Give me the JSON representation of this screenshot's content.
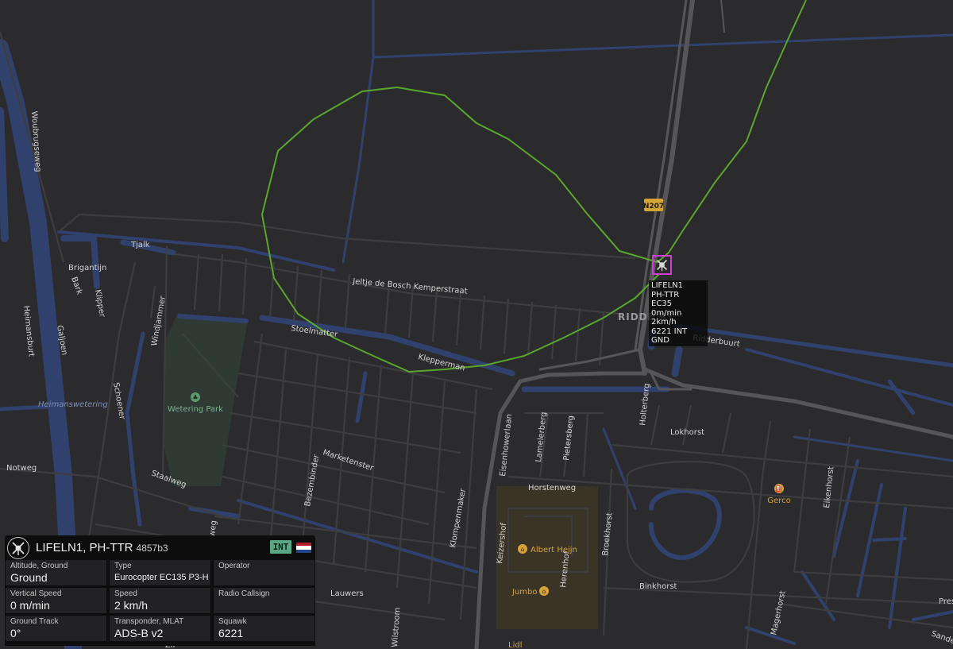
{
  "map": {
    "colors": {
      "background": "#2b2b2d",
      "water": "#30416e",
      "road": "#3d3d40",
      "highway": "#565659",
      "track": "#5aa72e",
      "park": "#2f3a34",
      "shopping": "#3a3426",
      "marker": "#d33cd6"
    },
    "road_shield": "N207",
    "area_label": "RIDDERVELD",
    "area_label_visible": "RIDDE      RT",
    "water_label": "Heimanswetering",
    "streets": {
      "woubrugseweg": "Woubrugseweg",
      "heimansburt": "Heimansburt",
      "galjoen": "Galjoen",
      "bark": "Bark",
      "klipper": "Klipper",
      "brigantijn": "Brigantijn",
      "tjalk": "Tjalk",
      "jeltje": "Jeltje de Bosch Kemperstraat",
      "stoelmatter": "Stoelmatter",
      "klepperman": "Klepperman",
      "windjammer": "Windjammer",
      "schoener": "Schoener",
      "notweg": "Notweg",
      "staalweg": "Staalweg",
      "markettenster": "Marketenster",
      "bezembinder": "Bezembinder",
      "klompenmaker": "Klompenmaker",
      "eisenhowerlaan": "Eisenhowerlaan",
      "lamelerberg": "Lamelerberg",
      "pietersberg": "Pietersberg",
      "horstenweg": "Horstenweg",
      "keizershof": "Keizershof",
      "herenhof": "Herenhof",
      "broekhorst": "Broekhorst",
      "binkhorst": "Binkhorst",
      "lokhorst": "Lokhorst",
      "holterberg": "Holterberg",
      "ridderbuurt": "Ridderbuurt",
      "eikenhorst": "Eikenhorst",
      "magerhorst": "Magerhorst",
      "lauwers": "Lauwers",
      "wilstroom": "Wilstroom",
      "weg": "weg",
      "pres": "Pres",
      "sanden": "Sanden",
      "zil": "Zil",
      "lidl": "Lidl"
    },
    "pois": {
      "park": "Wetering Park",
      "albert_heijn": "Albert Heijn",
      "jumbo": "Jumbo",
      "gerco": "Gerco"
    }
  },
  "aircraft_tag": {
    "lines": [
      "LIFELN1",
      "PH-TTR",
      "EC35",
      "0m/min",
      "2km/h",
      "6221 INT GND"
    ]
  },
  "panel": {
    "callsign_reg": "LIFELN1, PH-TTR",
    "hex": "4857b3",
    "badge": "INT",
    "flag_colors": [
      "#ae1c28",
      "#ffffff",
      "#21468b"
    ],
    "cells": [
      {
        "label": "Altitude, Ground",
        "value": ""
      },
      {
        "label": "",
        "value": "Ground"
      },
      {
        "label": "Type",
        "value": "Eurocopter EC135 P3-H"
      },
      {
        "label": "Operator",
        "value": ""
      },
      {
        "label": "Vertical Speed",
        "value": "0 m/min"
      },
      {
        "label": "Speed",
        "value": "2 km/h"
      },
      {
        "label": "Radio Callsign",
        "value": ""
      },
      {
        "label": "Ground Track",
        "value": "0°"
      },
      {
        "label": "Transponder, MLAT",
        "value": "ADS-B v2"
      },
      {
        "label": "Squawk",
        "value": "6221"
      }
    ]
  }
}
